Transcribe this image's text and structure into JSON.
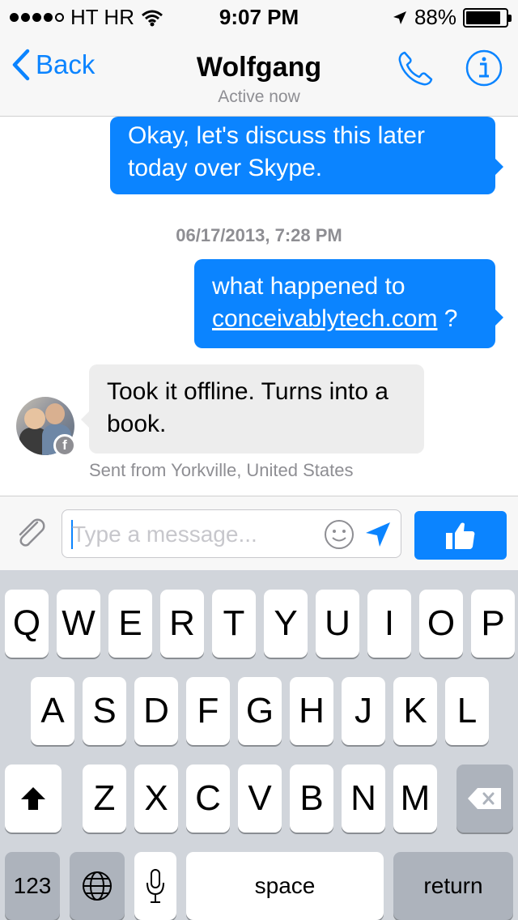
{
  "status_bar": {
    "carrier": "HT HR",
    "time": "9:07 PM",
    "battery": "88%",
    "battery_level": 0.88
  },
  "nav": {
    "back_label": "Back",
    "title": "Wolfgang",
    "subtitle": "Active now"
  },
  "messages": [
    {
      "direction": "out",
      "lines": [
        "Okay, let's discuss this later",
        "today over Skype."
      ]
    },
    {
      "direction": "out",
      "line1": "what happened to",
      "link": "conceivablytech.com",
      "suffix": " ?"
    },
    {
      "direction": "in",
      "lines": [
        "Took it offline. Turns into a",
        "book."
      ]
    }
  ],
  "timestamp": "06/17/2013, 7:28 PM",
  "fb_badge": "f",
  "sent_from": "Sent from Yorkville, United States",
  "composer": {
    "placeholder": "Type a message..."
  },
  "keyboard": {
    "row1": [
      "Q",
      "W",
      "E",
      "R",
      "T",
      "Y",
      "U",
      "I",
      "O",
      "P"
    ],
    "row2": [
      "A",
      "S",
      "D",
      "F",
      "G",
      "H",
      "J",
      "K",
      "L"
    ],
    "row3": [
      "Z",
      "X",
      "C",
      "V",
      "B",
      "N",
      "M"
    ],
    "numbers_label": "123",
    "space_label": "space",
    "return_label": "return"
  },
  "colors": {
    "accent": "#0b84ff",
    "incoming_bubble": "#ededed",
    "keyboard_bg": "#d1d5db"
  }
}
